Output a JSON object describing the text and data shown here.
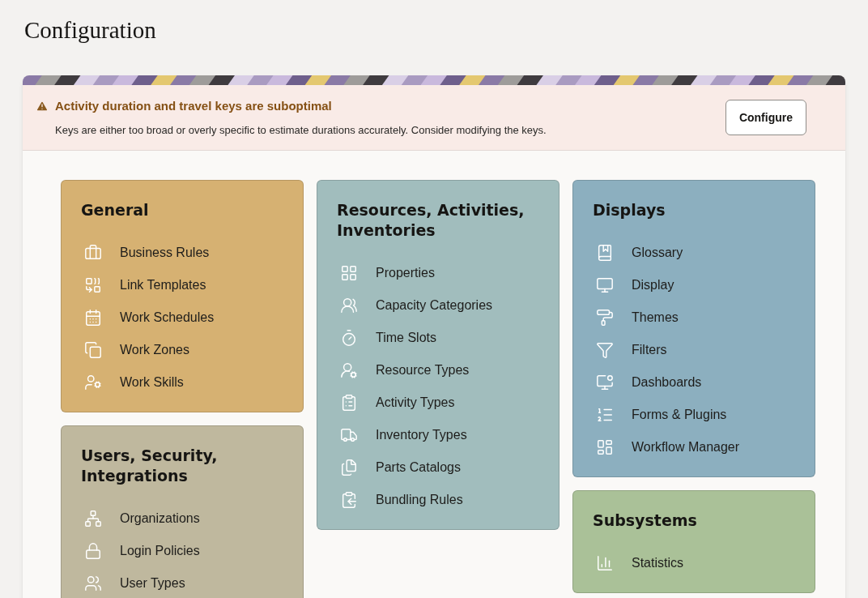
{
  "page": {
    "title": "Configuration"
  },
  "alert": {
    "title": "Activity duration and travel keys are suboptimal",
    "message": "Keys are either too broad or overly specific to estimate durations accurately. Consider modifying the keys.",
    "button": "Configure"
  },
  "columns": [
    [
      {
        "title": "General",
        "color": "#d6b172",
        "items": [
          "Business Rules",
          "Link Templates",
          "Work Schedules",
          "Work Zones",
          "Work Skills"
        ]
      },
      {
        "title": "Users, Security, Integrations",
        "color": "#bfb89e",
        "items": [
          "Organizations",
          "Login Policies",
          "User Types"
        ]
      }
    ],
    [
      {
        "title": "Resources, Activities, Inventories",
        "color": "#a1bdbd",
        "items": [
          "Properties",
          "Capacity Categories",
          "Time Slots",
          "Resource Types",
          "Activity Types",
          "Inventory Types",
          "Parts Catalogs",
          "Bundling Rules"
        ]
      }
    ],
    [
      {
        "title": "Displays",
        "color": "#8cafbf",
        "items": [
          "Glossary",
          "Display",
          "Themes",
          "Filters",
          "Dashboards",
          "Forms & Plugins",
          "Workflow Manager"
        ]
      },
      {
        "title": "Subsystems",
        "color": "#aac198",
        "items": [
          "Statistics"
        ]
      }
    ]
  ]
}
